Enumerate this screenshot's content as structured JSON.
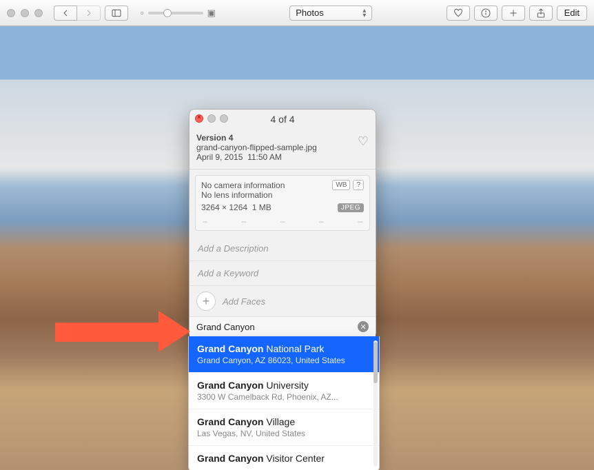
{
  "toolbar": {
    "view_selector": "Photos",
    "edit_label": "Edit",
    "slider_pos_pct": 28
  },
  "panel": {
    "title": "4 of 4",
    "version": "Version 4",
    "filename": "grand-canyon-flipped-sample.jpg",
    "date": "April 9, 2015",
    "time": "11:50 AM",
    "camera": "No camera information",
    "lens": "No lens information",
    "dimensions": "3264 × 1264",
    "filesize": "1 MB",
    "format_badge": "JPEG",
    "wb_badge": "WB",
    "help_badge": "?",
    "desc_placeholder": "Add a Description",
    "keyword_placeholder": "Add a Keyword",
    "faces_label": "Add Faces",
    "location_value": "Grand Canyon"
  },
  "suggestions": [
    {
      "bold": "Grand Canyon",
      "rest": " National Park",
      "sub": "Grand Canyon, AZ 86023, United States",
      "selected": true
    },
    {
      "bold": "Grand Canyon",
      "rest": " University",
      "sub": "3300 W Camelback Rd, Phoenix, AZ...",
      "selected": false
    },
    {
      "bold": "Grand Canyon",
      "rest": " Village",
      "sub": "Las Vegas, NV, United States",
      "selected": false
    },
    {
      "bold": "Grand Canyon",
      "rest": " Visitor Center",
      "sub": "",
      "selected": false
    }
  ]
}
